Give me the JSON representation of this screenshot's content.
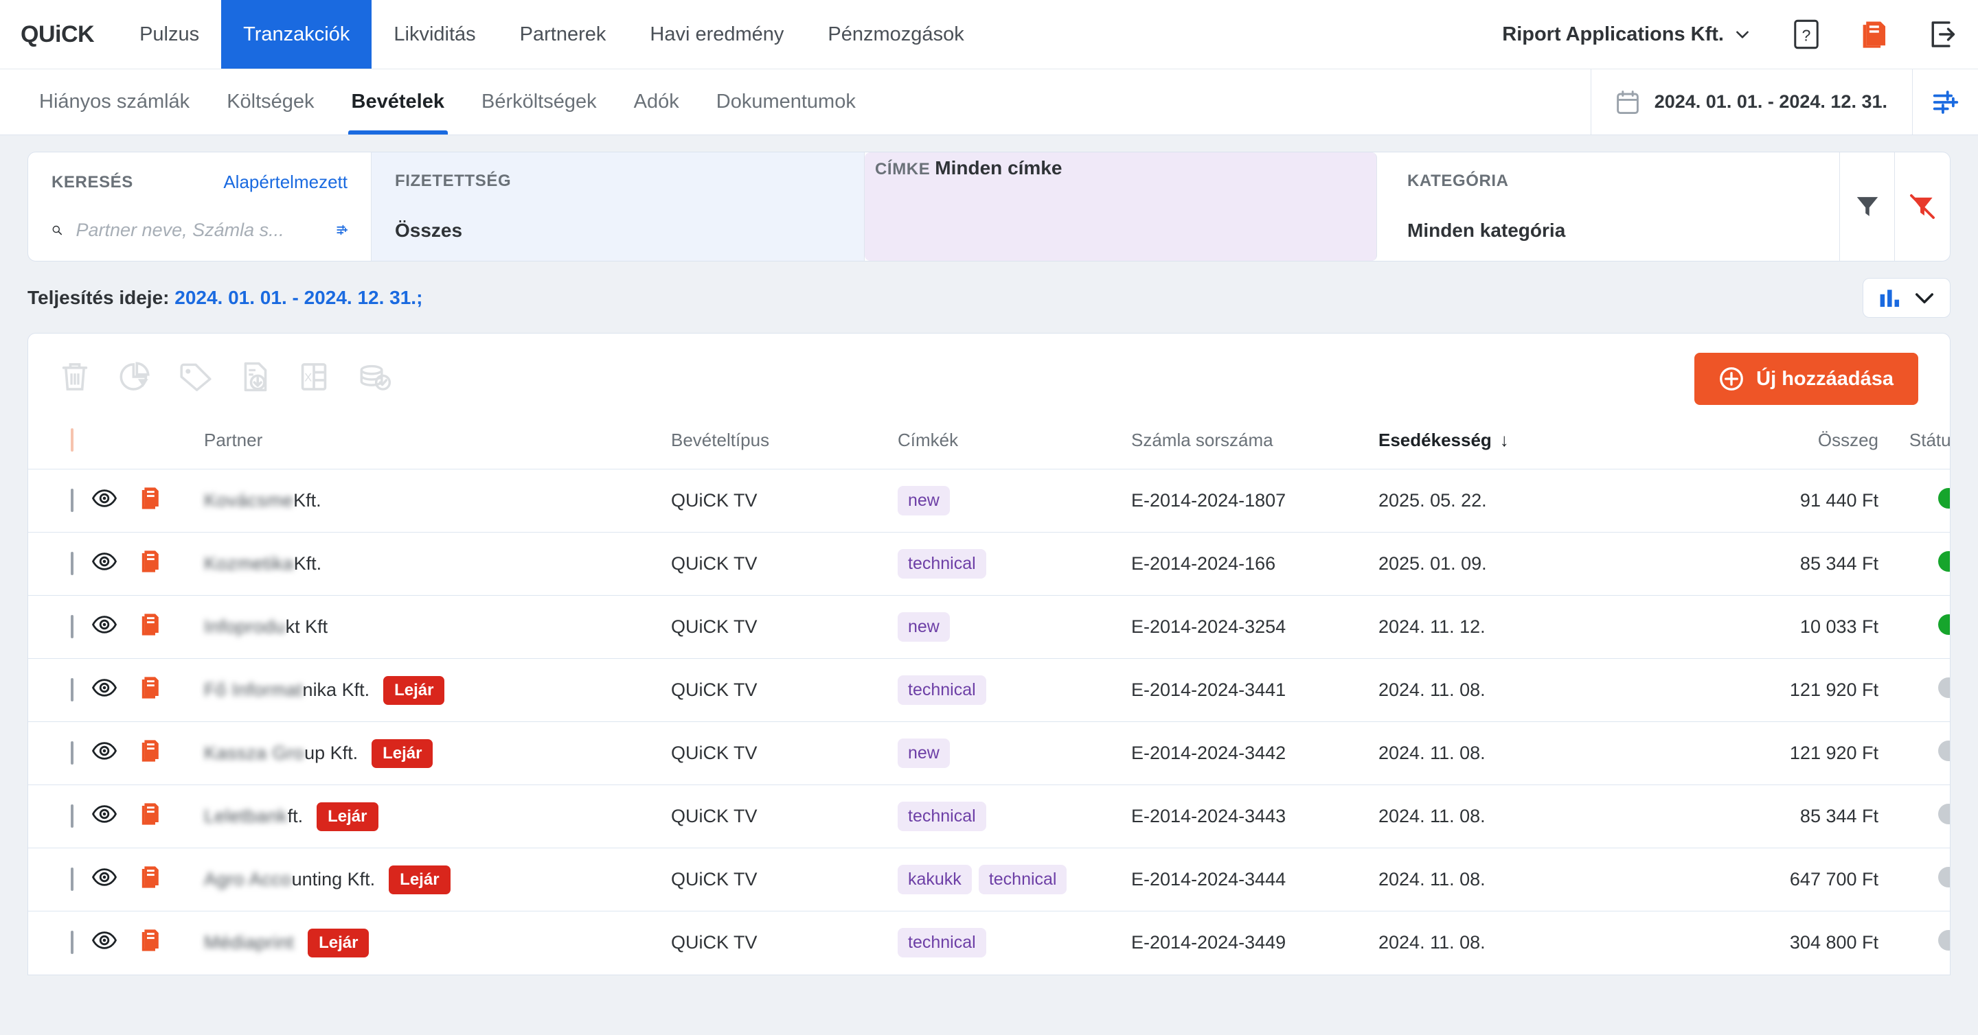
{
  "brand": {
    "name": "QUiCK"
  },
  "mainnav": {
    "items": [
      {
        "label": "Pulzus",
        "active": false
      },
      {
        "label": "Tranzakciók",
        "active": true
      },
      {
        "label": "Likviditás",
        "active": false
      },
      {
        "label": "Partnerek",
        "active": false
      },
      {
        "label": "Havi eredmény",
        "active": false
      },
      {
        "label": "Pénzmozgások",
        "active": false
      }
    ],
    "company": "Riport Applications Kft.",
    "help_icon": "question-mark-icon",
    "docs_icon": "book-icon",
    "logout_icon": "logout-icon"
  },
  "subnav": {
    "items": [
      {
        "label": "Hiányos számlák",
        "active": false
      },
      {
        "label": "Költségek",
        "active": false
      },
      {
        "label": "Bevételek",
        "active": true
      },
      {
        "label": "Bérköltségek",
        "active": false
      },
      {
        "label": "Adók",
        "active": false
      },
      {
        "label": "Dokumentumok",
        "active": false
      }
    ],
    "date_range": "2024. 01. 01. - 2024. 12. 31.",
    "calendar_icon": "calendar-icon",
    "settings_icon": "sliders-icon"
  },
  "filters": {
    "search": {
      "label": "KERESÉS",
      "reset_link": "Alapértelmezett",
      "placeholder": "Partner neve, Számla s...",
      "value": "",
      "search_icon": "search-icon",
      "options_icon": "sliders-icon"
    },
    "payment": {
      "label": "FIZETETTSÉG",
      "value": "Összes"
    },
    "tag": {
      "label": "CÍMKE",
      "value": "Minden címke"
    },
    "category": {
      "label": "KATEGÓRIA",
      "value": "Minden kategória"
    },
    "filter_icon": "funnel-icon",
    "clear_filter_icon": "funnel-clear-icon"
  },
  "summary": {
    "prefix": "Teljesítés ideje:",
    "value": "2024. 01. 01. - 2024. 12. 31.;",
    "chart_icon": "bar-chart-icon",
    "chevron_icon": "chevron-down-icon"
  },
  "toolbar": {
    "icons": [
      "trash-icon",
      "pie-chart-icon",
      "tag-icon",
      "file-download-icon",
      "excel-icon",
      "coins-check-icon"
    ],
    "add_label": "Új hozzáadása",
    "add_icon": "plus-circle-icon",
    "add_color": "#ee5527"
  },
  "table": {
    "columns": [
      {
        "key": "partner",
        "label": "Partner"
      },
      {
        "key": "type",
        "label": "Bevételtípus"
      },
      {
        "key": "tags",
        "label": "Címkék"
      },
      {
        "key": "invoice",
        "label": "Számla sorszáma"
      },
      {
        "key": "due",
        "label": "Esedékesség",
        "sorted": true,
        "sort_dir": "↓"
      },
      {
        "key": "amount",
        "label": "Összeg"
      },
      {
        "key": "status",
        "label": "Státuszok"
      }
    ],
    "row_icons": {
      "view": "eye-icon",
      "document": "invoice-icon"
    },
    "rows": [
      {
        "partner_blurred": "Kovácsme",
        "partner_visible": "Kft.",
        "overdue": false,
        "type": "QUiCK TV",
        "tags": [
          "new"
        ],
        "invoice": "E-2014-2024-1807",
        "due": "2025. 05. 22.",
        "amount": "91 440 Ft",
        "status": "green"
      },
      {
        "partner_blurred": "Kozmetika",
        "partner_visible": "Kft.",
        "overdue": false,
        "type": "QUiCK TV",
        "tags": [
          "technical"
        ],
        "invoice": "E-2014-2024-166",
        "due": "2025. 01. 09.",
        "amount": "85 344 Ft",
        "status": "green"
      },
      {
        "partner_blurred": "Infoprodu",
        "partner_visible": "kt Kft",
        "overdue": false,
        "type": "QUiCK TV",
        "tags": [
          "new"
        ],
        "invoice": "E-2014-2024-3254",
        "due": "2024. 11. 12.",
        "amount": "10 033 Ft",
        "status": "green"
      },
      {
        "partner_blurred": "Fő Informat",
        "partner_visible": "nika Kft.",
        "overdue": true,
        "type": "QUiCK TV",
        "tags": [
          "technical"
        ],
        "invoice": "E-2014-2024-3441",
        "due": "2024. 11. 08.",
        "amount": "121 920 Ft",
        "status": "grey"
      },
      {
        "partner_blurred": "Kassza Gro",
        "partner_visible": "up Kft.",
        "overdue": true,
        "type": "QUiCK TV",
        "tags": [
          "new"
        ],
        "invoice": "E-2014-2024-3442",
        "due": "2024. 11. 08.",
        "amount": "121 920 Ft",
        "status": "grey"
      },
      {
        "partner_blurred": "Leletbank",
        "partner_visible": "ft.",
        "overdue": true,
        "type": "QUiCK TV",
        "tags": [
          "technical"
        ],
        "invoice": "E-2014-2024-3443",
        "due": "2024. 11. 08.",
        "amount": "85 344 Ft",
        "status": "grey"
      },
      {
        "partner_blurred": "Agro Acco",
        "partner_visible": "unting Kft.",
        "overdue": true,
        "type": "QUiCK TV",
        "tags": [
          "kakukk",
          "technical"
        ],
        "invoice": "E-2014-2024-3444",
        "due": "2024. 11. 08.",
        "amount": "647 700 Ft",
        "status": "grey"
      },
      {
        "partner_blurred": "Médiaprint",
        "partner_visible": "",
        "overdue": true,
        "type": "QUiCK TV",
        "tags": [
          "technical"
        ],
        "invoice": "E-2014-2024-3449",
        "due": "2024. 11. 08.",
        "amount": "304 800 Ft",
        "status": "grey"
      }
    ],
    "overdue_badge": "Lejár"
  }
}
